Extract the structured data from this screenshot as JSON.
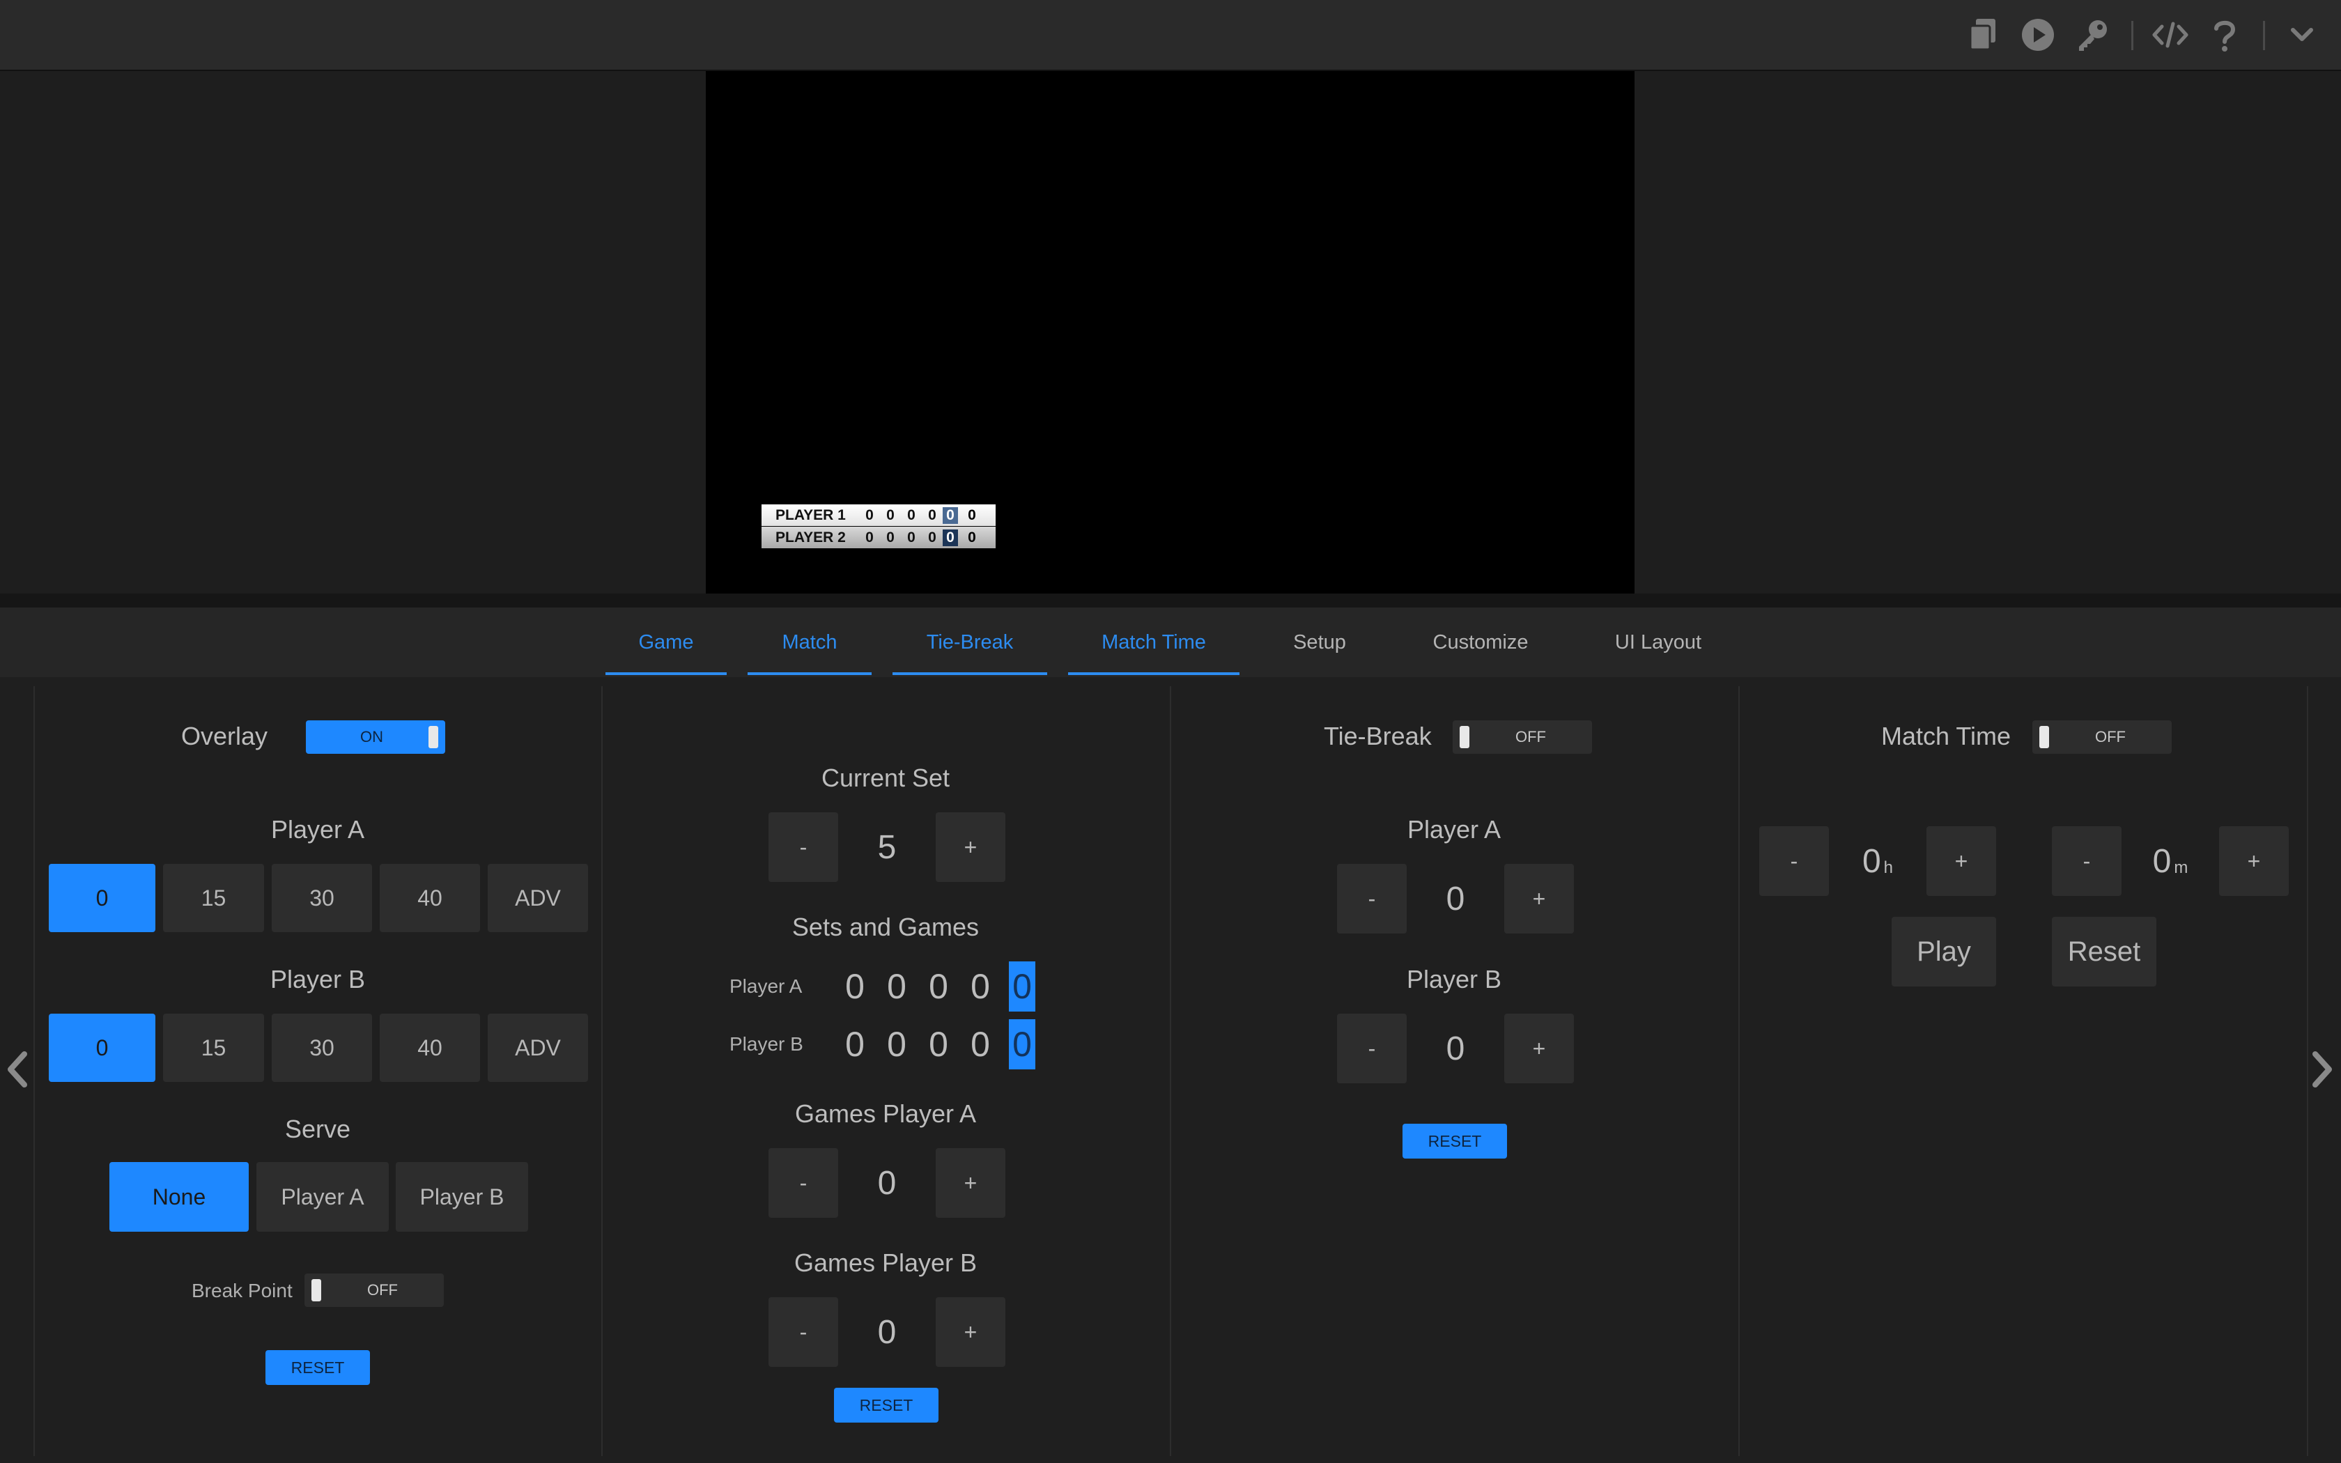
{
  "tabs": [
    {
      "label": "Game",
      "active": true
    },
    {
      "label": "Match",
      "active": true
    },
    {
      "label": "Tie-Break",
      "active": true
    },
    {
      "label": "Match Time",
      "active": true
    },
    {
      "label": "Setup",
      "active": false
    },
    {
      "label": "Customize",
      "active": false
    },
    {
      "label": "UI Layout",
      "active": false
    }
  ],
  "toolbar_icons": [
    "copy-icon",
    "play-icon",
    "key-icon",
    "code-icon",
    "help-icon",
    "chevron-down-icon"
  ],
  "scoreboard": {
    "rows": [
      {
        "name": "PLAYER 1",
        "sets": [
          "0",
          "0",
          "0",
          "0"
        ],
        "current": "0",
        "points": "0"
      },
      {
        "name": "PLAYER 2",
        "sets": [
          "0",
          "0",
          "0",
          "0"
        ],
        "current": "0",
        "points": "0"
      }
    ]
  },
  "game": {
    "overlay_label": "Overlay",
    "overlay_state": "ON",
    "player_a_label": "Player A",
    "player_b_label": "Player B",
    "points_options": [
      "0",
      "15",
      "30",
      "40",
      "ADV"
    ],
    "player_a_selected": "0",
    "player_b_selected": "0",
    "serve_label": "Serve",
    "serve_options": [
      "None",
      "Player A",
      "Player B"
    ],
    "serve_selected": "None",
    "break_point_label": "Break Point",
    "break_point_state": "OFF",
    "reset_label": "RESET"
  },
  "match": {
    "current_set_label": "Current Set",
    "current_set_value": "5",
    "sets_games_label": "Sets and Games",
    "row_a_label": "Player A",
    "row_b_label": "Player B",
    "row_a_values": [
      "0",
      "0",
      "0",
      "0",
      "0"
    ],
    "row_b_values": [
      "0",
      "0",
      "0",
      "0",
      "0"
    ],
    "games_a_label": "Games Player A",
    "games_a_value": "0",
    "games_b_label": "Games Player B",
    "games_b_value": "0",
    "minus": "-",
    "plus": "+",
    "reset_label": "RESET"
  },
  "tiebreak": {
    "label": "Tie-Break",
    "state": "OFF",
    "player_a_label": "Player A",
    "player_a_value": "0",
    "player_b_label": "Player B",
    "player_b_value": "0",
    "reset_label": "RESET"
  },
  "match_time": {
    "label": "Match Time",
    "state": "OFF",
    "hours_value": "0",
    "hours_unit": "h",
    "minutes_value": "0",
    "minutes_unit": "m",
    "play_label": "Play",
    "reset_label": "Reset"
  },
  "colors": {
    "accent": "#1e88ff",
    "tab_active": "#2d8cf0",
    "background": "#1f1f1f"
  }
}
